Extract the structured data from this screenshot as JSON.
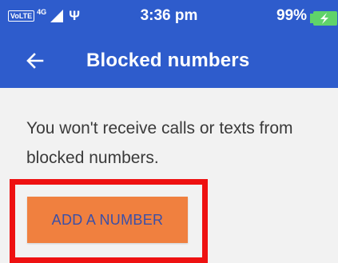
{
  "status_bar": {
    "volte_label": "VoLTE",
    "network_label": "4G",
    "usb_glyph": "Ψ",
    "time": "3:36 pm",
    "battery_percent": "99%",
    "battery_icon": "battery-charging-icon",
    "signal_icon": "signal-icon",
    "usb_icon": "usb-icon"
  },
  "app_bar": {
    "title": "Blocked numbers",
    "back_icon": "arrow-left-icon"
  },
  "main": {
    "message": "You won't receive calls or texts from blocked numbers.",
    "add_button_label": "ADD A NUMBER"
  },
  "colors": {
    "app_bar": "#2e5ccc",
    "background": "#f2f2f2",
    "button": "#f0803f",
    "button_text": "#3a4fa8",
    "highlight": "#ee1111",
    "battery": "#5fd36a"
  }
}
